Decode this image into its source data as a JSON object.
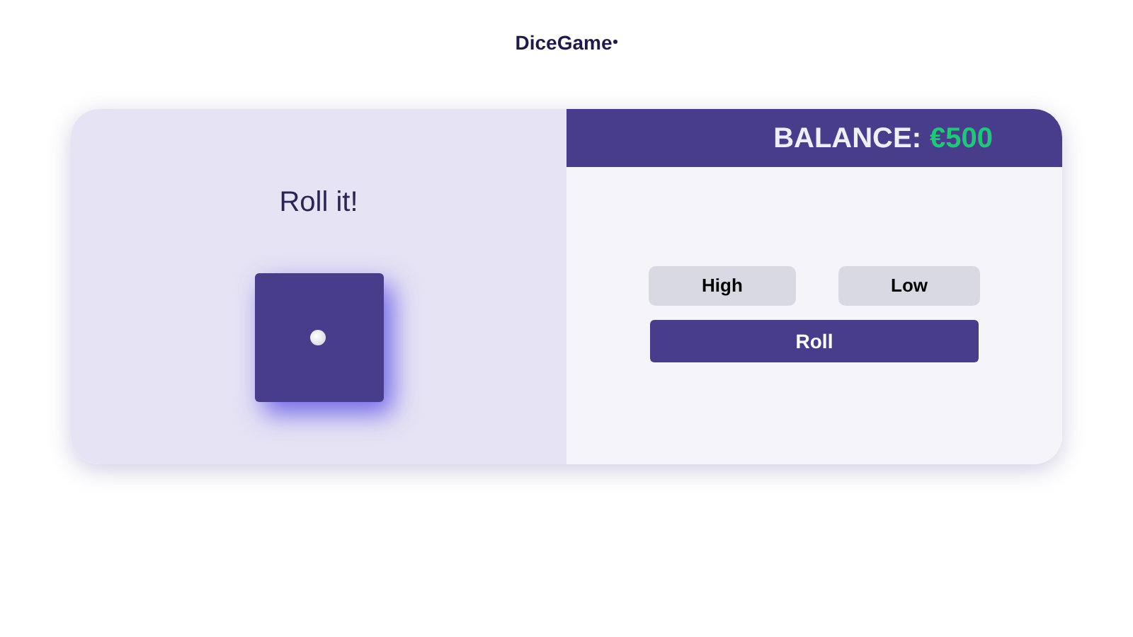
{
  "logo": {
    "text": "DiceGame"
  },
  "game": {
    "heading": "Roll it!",
    "die": {
      "kind": "one"
    }
  },
  "balance": {
    "label": "BALANCE:",
    "amount": "€500"
  },
  "bets": [
    {
      "label": "High"
    },
    {
      "label": "Low"
    }
  ],
  "roll_button": {
    "label": "Roll"
  }
}
